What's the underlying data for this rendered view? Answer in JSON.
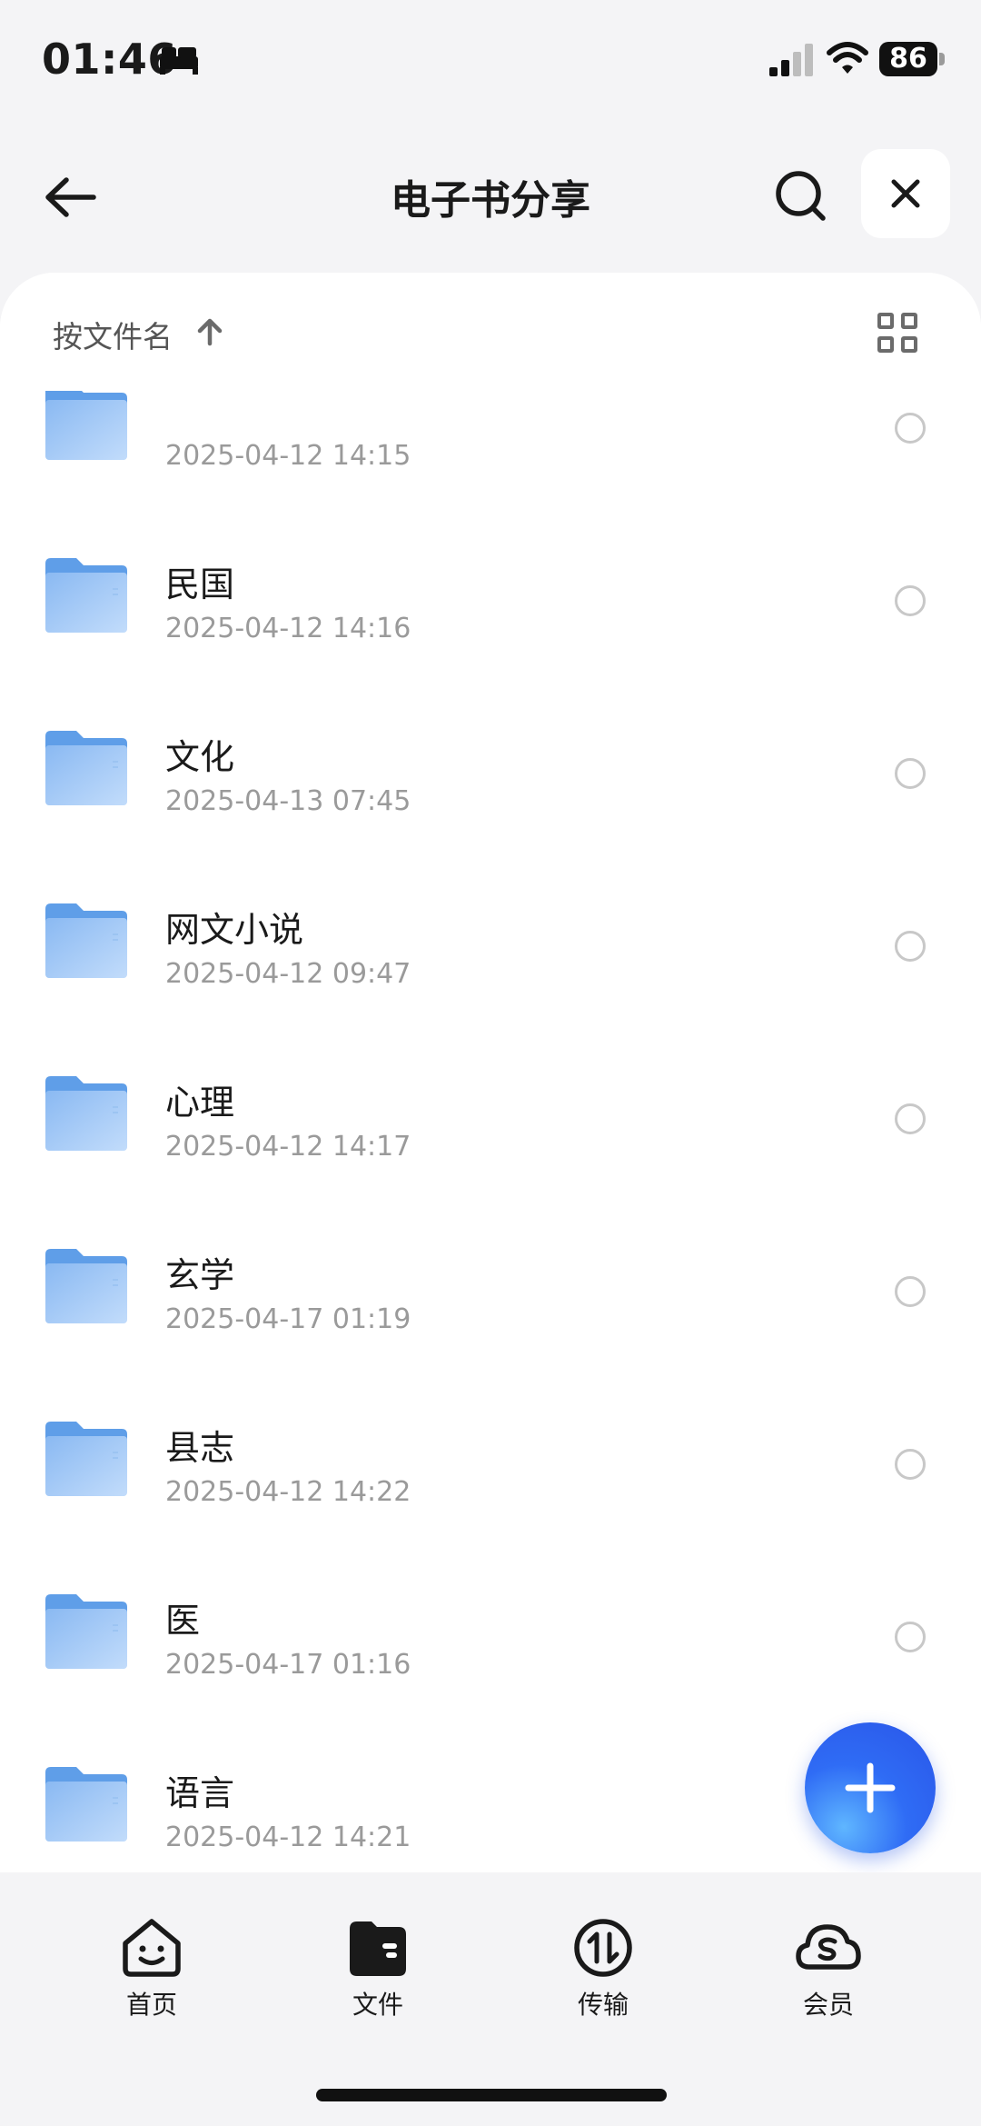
{
  "status_bar": {
    "time": "01:46",
    "battery": "86"
  },
  "header": {
    "title": "电子书分享"
  },
  "sort": {
    "label": "按文件名"
  },
  "folders": [
    {
      "name": "",
      "date": "2025-04-12 14:15"
    },
    {
      "name": "民国",
      "date": "2025-04-12 14:16"
    },
    {
      "name": "文化",
      "date": "2025-04-13 07:45"
    },
    {
      "name": "网文小说",
      "date": "2025-04-12 09:47"
    },
    {
      "name": "心理",
      "date": "2025-04-12 14:17"
    },
    {
      "name": "玄学",
      "date": "2025-04-17 01:19"
    },
    {
      "name": "县志",
      "date": "2025-04-12 14:22"
    },
    {
      "name": "医",
      "date": "2025-04-17 01:16"
    },
    {
      "name": "语言",
      "date": "2025-04-12 14:21"
    }
  ],
  "bottom_nav": {
    "items": [
      {
        "label": "首页",
        "icon": "home-face-icon"
      },
      {
        "label": "文件",
        "icon": "folder-icon"
      },
      {
        "label": "传输",
        "icon": "transfer-icon"
      },
      {
        "label": "会员",
        "icon": "vip-cloud-icon"
      }
    ],
    "active": "文件"
  },
  "colors": {
    "accent": "#2f6cf5",
    "folder": "#7fb2f0",
    "date_text": "#9a9a9a"
  }
}
